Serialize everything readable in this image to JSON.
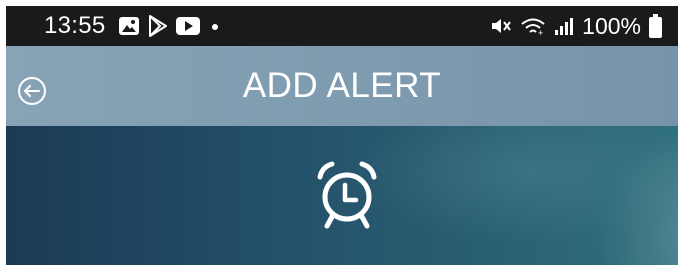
{
  "status_bar": {
    "time": "13:55",
    "battery_percent": "100%",
    "notification_icons": [
      "gallery-icon",
      "play-store-icon",
      "youtube-icon",
      "dot-icon"
    ],
    "system_icons": [
      "mute-icon",
      "wifi-icon",
      "signal-icon",
      "battery-icon"
    ]
  },
  "app_bar": {
    "title": "ADD ALERT",
    "back_icon": "back-arrow-icon"
  },
  "hero": {
    "icon": "alarm-clock-icon"
  },
  "colors": {
    "status_bar_bg": "#1a1a1a",
    "app_bar_bg": "#809db1",
    "hero_bg_start": "#1b3a55",
    "hero_bg_end": "#30707d",
    "foreground": "#ffffff"
  }
}
